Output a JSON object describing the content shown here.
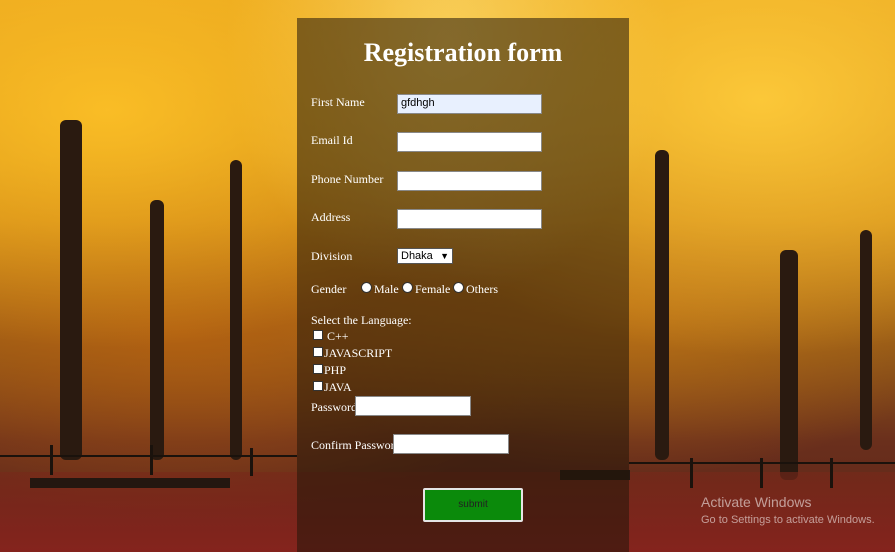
{
  "form": {
    "title": "Registration form",
    "first_name_label": "First Name",
    "first_name_value": "gfdhgh",
    "email_label": "Email Id",
    "email_value": "",
    "phone_label": "Phone Number",
    "phone_value": "",
    "address_label": "Address",
    "address_value": "",
    "division_label": "Division",
    "division_value": "Dhaka",
    "gender_label": "Gender",
    "gender_options": [
      "Male",
      "Female",
      "Others"
    ],
    "language_label": "Select the Language:",
    "languages": [
      "C++",
      "JAVASCRIPT",
      "PHP",
      "JAVA"
    ],
    "password_label": "Password",
    "password_value": "",
    "confirm_password_label": "Confirm Password",
    "confirm_password_value": "",
    "submit_label": "submit"
  },
  "os_watermark": {
    "line1": "Activate Windows",
    "line2": "Go to Settings to activate Windows."
  },
  "colors": {
    "submit_bg": "#0b8a0b",
    "panel_bg": "rgba(35,22,10,0.55)"
  },
  "icons": {
    "division_dropdown": "chevron-down-icon"
  }
}
